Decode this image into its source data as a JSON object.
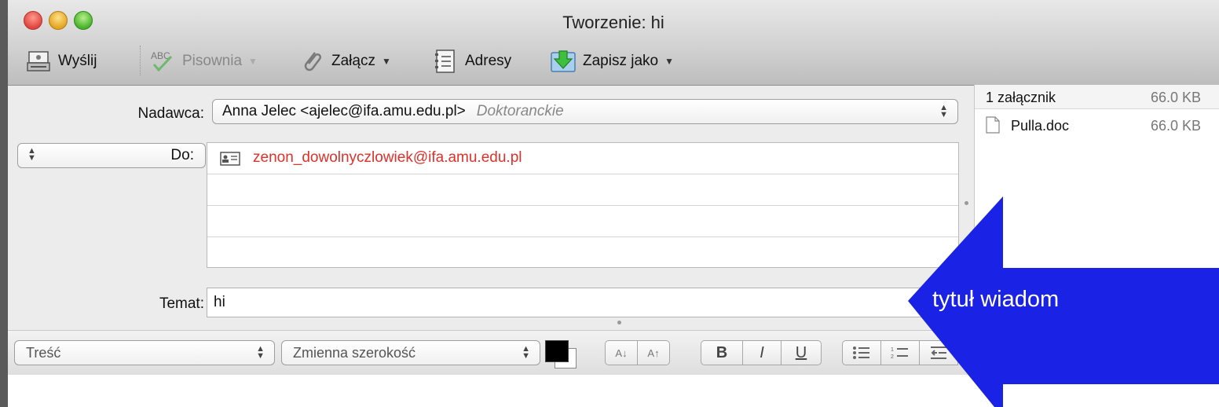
{
  "window": {
    "title": "Tworzenie: hi"
  },
  "toolbar": {
    "send": "Wyślij",
    "spelling": "Pisownia",
    "attach": "Załącz",
    "addresses": "Adresy",
    "save_as": "Zapisz jako"
  },
  "header": {
    "from_label": "Nadawca:",
    "from_value": "Anna Jelec <ajelec@ifa.amu.edu.pl>",
    "from_account": "Doktoranckie",
    "to_label": "Do:",
    "to_value": "zenon_dowolnyczlowiek@ifa.amu.edu.pl",
    "subject_label": "Temat:",
    "subject_value": "hi"
  },
  "attachments": {
    "summary": "1 załącznik",
    "total_size": "66.0 KB",
    "items": [
      {
        "name": "Pulla.doc",
        "size": "66.0 KB"
      }
    ]
  },
  "format_bar": {
    "style": "Treść",
    "font": "Zmienna szerokość",
    "bold": "B",
    "italic": "I",
    "underline": "U"
  },
  "annotation": {
    "text": "tytuł wiadom"
  },
  "colors": {
    "recipient": "#e0302a",
    "annotation_arrow": "#1a22e6"
  }
}
